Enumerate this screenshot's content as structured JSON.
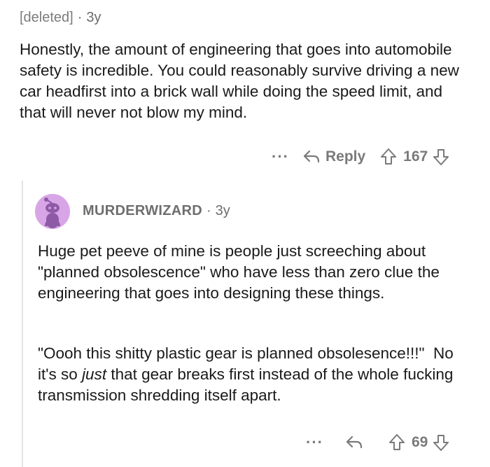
{
  "parent_comment": {
    "author": "[deleted]",
    "age": "3y",
    "body": "Honestly, the amount of engineering that goes into automobile safety is incredible. You could reasonably survive driving a new car headfirst into a brick wall while doing the speed limit, and that will never not blow my mind.",
    "actions": {
      "more": "···",
      "reply_label": "Reply",
      "score": "167"
    }
  },
  "reply_comment": {
    "author": "MURDERWIZARD",
    "age": "3y",
    "paragraph1": "Huge pet peeve of mine is people just screeching about \"planned obsolescence\" who have less than zero clue the engineering that goes into designing these things.",
    "paragraph2_before": "\"Oooh this shitty plastic gear is planned obsolesence!!!\"  No it's so ",
    "paragraph2_emphasis": "just",
    "paragraph2_after": " that gear breaks first instead of the whole fucking transmission shredding itself apart.",
    "actions": {
      "more": "···",
      "score": "69"
    }
  },
  "icons": {
    "more": "ellipsis-icon",
    "reply": "reply-arrow-icon",
    "upvote": "upvote-arrow-icon",
    "downvote": "downvote-arrow-icon",
    "avatar": "reddit-snoo-avatar-icon"
  },
  "colors": {
    "avatar_bg": "#d8a6e6",
    "avatar_figure": "#8e5aa6",
    "meta_text": "#6b6b6b",
    "body_text": "#1a1a1b"
  }
}
